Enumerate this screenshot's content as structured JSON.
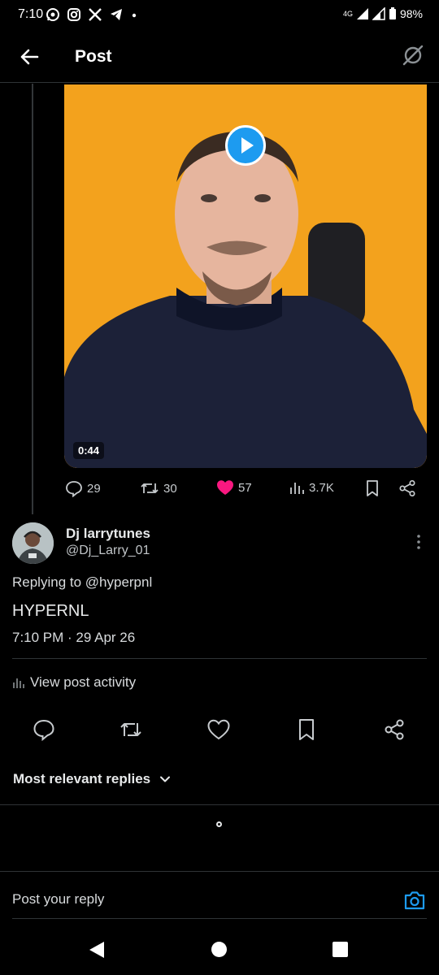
{
  "status_bar": {
    "time": "7:10",
    "network": "4G",
    "battery": "98%",
    "app_icons": [
      "whatsapp-icon",
      "instagram-icon",
      "x-icon",
      "telegram-icon",
      "dot-icon"
    ]
  },
  "header": {
    "title": "Post"
  },
  "video": {
    "duration": "0:44",
    "background_color": "#f3a21d",
    "play_color": "#1d9bf0"
  },
  "quoted_actions": {
    "replies": "29",
    "reposts": "30",
    "likes": "57",
    "views": "3.7K",
    "like_color": "#f91880"
  },
  "post": {
    "author_name": "Dj larrytunes",
    "author_handle": "@Dj_Larry_01",
    "replying_to": "Replying to @hyperpnl",
    "text": "HYPERNL",
    "timestamp": "7:10 PM · 29 Apr 26",
    "activity_label": "View post activity"
  },
  "replies_section": {
    "sort_label": "Most relevant replies"
  },
  "composer": {
    "placeholder": "Post your reply",
    "accent": "#1d9bf0"
  }
}
